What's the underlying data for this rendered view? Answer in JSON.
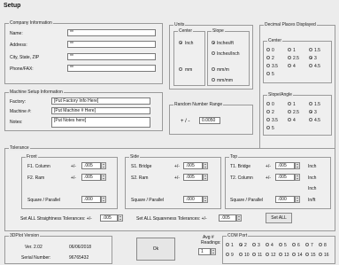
{
  "title": "Setup",
  "company": {
    "legend": "Company Information",
    "fields": [
      {
        "label": "Name:",
        "value": "**"
      },
      {
        "label": "Address:",
        "value": "**"
      },
      {
        "label": "City, State, ZIP",
        "value": "**"
      },
      {
        "label": "Phone/FAX:",
        "value": "**"
      }
    ]
  },
  "machine": {
    "legend": "Machine Setup Information",
    "fields": [
      {
        "label": "Factory:",
        "value": "[Put Factory Info Here]"
      },
      {
        "label": "Machine #:",
        "value": "[Put Machine # Here]"
      },
      {
        "label": "Notes:",
        "value": "[Put Notes here]"
      }
    ]
  },
  "units": {
    "legend": "Units",
    "center": {
      "label": "Center",
      "options": [
        "Inch",
        "mm"
      ],
      "selected": 0
    },
    "slope": {
      "label": "Slope",
      "options": [
        "Inches/ft",
        "Inches/Inch",
        "mm/m",
        "mm/mm"
      ],
      "selected": 0
    }
  },
  "random": {
    "legend": "Random Number Range",
    "prefix": "+ / -",
    "value": "0.0050"
  },
  "decimal": {
    "legend": "Decimal Places Displayed",
    "center": {
      "label": "Center",
      "options": [
        "0",
        "1",
        "1.5",
        "2",
        "2.5",
        "3",
        "3.5",
        "4",
        "4.5",
        "5"
      ],
      "selected": 5
    },
    "slope": {
      "label": "Slope/Angle",
      "options": [
        "0",
        "1",
        "1.5",
        "2",
        "2.5",
        "3",
        "3.5",
        "4",
        "4.5",
        "5"
      ],
      "selected": 5
    }
  },
  "tolerance": {
    "legend": "Tolerance",
    "front": {
      "label": "Front",
      "rows": [
        {
          "label": "F1. Column",
          "sign": "+/-",
          "value": ".005"
        },
        {
          "label": "F2. Ram",
          "sign": "+/-",
          "value": ".005"
        }
      ],
      "sq_label": "Square / Parallel",
      "sq_value": ".000"
    },
    "side": {
      "label": "Side",
      "rows": [
        {
          "label": "S1. Bridge",
          "sign": "+/-",
          "value": ".005"
        },
        {
          "label": "S2. Ram",
          "sign": "+/-",
          "value": ".005"
        }
      ],
      "sq_label": "Square / Parallel",
      "sq_value": ".000"
    },
    "top": {
      "label": "Top",
      "rows": [
        {
          "label": "T1. Bridge",
          "sign": "+/-",
          "value": ".005",
          "unit": "Inch"
        },
        {
          "label": "T2. Column",
          "sign": "+/-",
          "value": ".005",
          "unit": "Inch"
        }
      ],
      "extra_unit": "Inch",
      "sq_label": "Square / Parallel",
      "sq_value": ".000",
      "sq_unit": "In/ft"
    }
  },
  "set_all": {
    "straight_label": "Set ALL Straightness Tolerances: +/-",
    "straight_value": ".005",
    "square_label": "Set ALL Squareness Tolerances: +/-",
    "square_value": ".005",
    "button": "Set ALL"
  },
  "version": {
    "legend": "3DPlot Version",
    "ver_label": "Ver. 2.02",
    "date": "06/06/2018",
    "serial_label": "Serial Number:",
    "serial": "96765432"
  },
  "ok_button": "Ok",
  "avg": {
    "label": "Avg #",
    "label2": "Readings:",
    "value": "1"
  },
  "com": {
    "legend": "COM Port",
    "options": [
      "1",
      "2",
      "3",
      "4",
      "5",
      "6",
      "7",
      "8",
      "9",
      "10",
      "11",
      "12",
      "13",
      "14",
      "15",
      "16"
    ],
    "selected": 1
  }
}
